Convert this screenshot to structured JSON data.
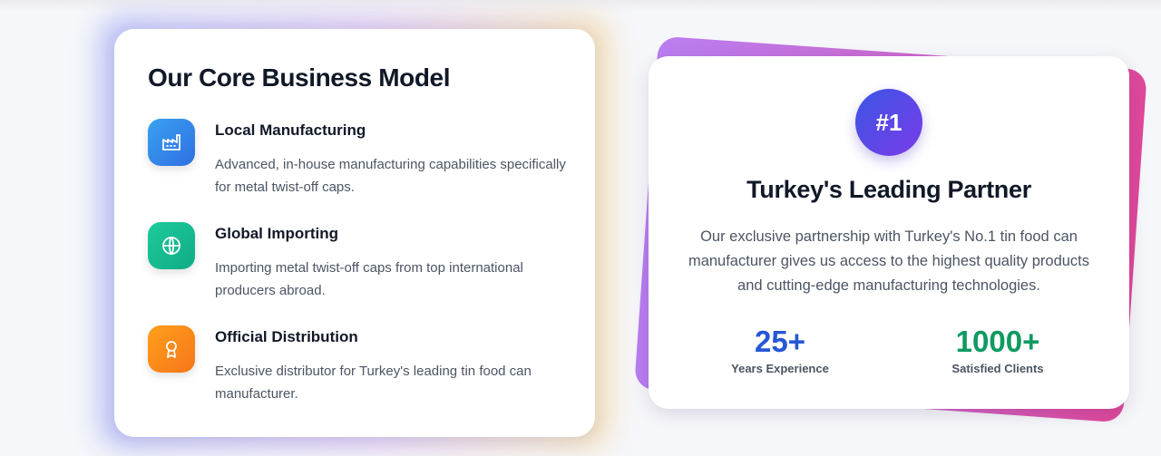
{
  "business_model": {
    "title": "Our Core Business Model",
    "features": [
      {
        "title": "Local Manufacturing",
        "description": "Advanced, in-house manufacturing capabilities specifically for metal twist-off caps.",
        "icon": "factory-icon",
        "color_from": "#38a2ee",
        "color_to": "#2f6fe4"
      },
      {
        "title": "Global Importing",
        "description": "Importing metal twist-off caps from top international producers abroad.",
        "icon": "globe-icon",
        "color_from": "#1ccb9b",
        "color_to": "#11ab86"
      },
      {
        "title": "Official Distribution",
        "description": "Exclusive distributor for Turkey's leading tin food can manufacturer.",
        "icon": "award-icon",
        "color_from": "#fea01a",
        "color_to": "#f7751a"
      }
    ]
  },
  "partner": {
    "badge": "#1",
    "title": "Turkey's Leading Partner",
    "description": "Our exclusive partnership with Turkey's No.1 tin food can manufacturer gives us access to the highest quality products and cutting-edge manufacturing technologies.",
    "stats": [
      {
        "value": "25+",
        "label": "Years Experience",
        "color": "#2557d6"
      },
      {
        "value": "1000+",
        "label": "Satisfied Clients",
        "color": "#0f9a62"
      }
    ]
  }
}
